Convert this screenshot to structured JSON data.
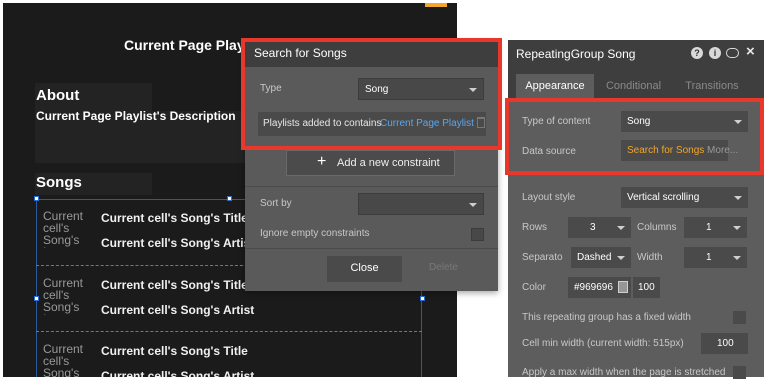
{
  "canvas": {
    "page_title": "Current Page Playlist",
    "about_heading": "About",
    "description": "Current Page Playlist's Description",
    "songs_heading": "Songs",
    "cells": [
      {
        "image_text": "Current cell's Song's Image",
        "title": "Current cell's Song's Title",
        "artist": "Current cell's Song's Artist"
      },
      {
        "image_text": "Current cell's Song's Image",
        "title": "Current cell's Song's Title",
        "artist": "Current cell's Song's Artist"
      },
      {
        "image_text": "Current cell's Song's Image",
        "title": "Current cell's Song's Title",
        "artist": "Current cell's Song's Artist"
      }
    ]
  },
  "search_dialog": {
    "title": "Search for Songs",
    "type_label": "Type",
    "type_value": "Song",
    "constraint_field": "Playlists added to contains",
    "constraint_value": "Current Page Playlist",
    "add_constraint_label": "Add a new constraint",
    "sort_by_label": "Sort by",
    "sort_by_value": "",
    "ignore_empty_label": "Ignore empty constraints",
    "close_label": "Close",
    "delete_label": "Delete"
  },
  "property_panel": {
    "title": "RepeatingGroup Song",
    "tabs": [
      "Appearance",
      "Conditional",
      "Transitions"
    ],
    "type_of_content_label": "Type of content",
    "type_of_content_value": "Song",
    "data_source_label": "Data source",
    "data_source_value": "Search for Songs",
    "data_source_more": "More...",
    "layout_style_label": "Layout style",
    "layout_style_value": "Vertical scrolling",
    "rows_label": "Rows",
    "rows_value": "3",
    "columns_label": "Columns",
    "columns_value": "1",
    "separator_label": "Separato",
    "separator_value": "Dashed",
    "width_label": "Width",
    "width_value": "1",
    "color_label": "Color",
    "color_value": "#969696",
    "opacity_value": "100",
    "fixed_width_label": "This repeating group has a fixed width",
    "cell_min_width_label": "Cell min width (current width: 515px)",
    "cell_min_width_value": "100",
    "max_width_label": "Apply a max width when the page is stretched"
  },
  "colors": {
    "highlight_red": "#e8382c",
    "link_blue": "#5aa6ee",
    "data_source_orange": "#f2a62b",
    "selection_blue": "#2b6bd6"
  }
}
